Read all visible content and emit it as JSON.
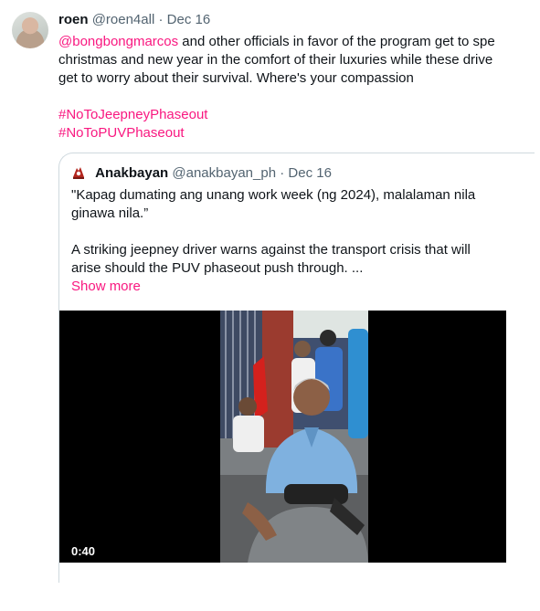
{
  "tweet": {
    "author_name": "roen",
    "author_handle": "@roen4all",
    "date": "Dec 16",
    "separator": " · ",
    "lines": [
      {
        "mention": "@bongbongmarcos",
        "text": " and other officials in favor of the program get to spe"
      },
      {
        "text": "christmas and new year in the comfort of their luxuries while these drive"
      },
      {
        "text": "get to worry about their survival. Where's your compassion"
      }
    ],
    "hashtags": [
      "#NoToJeepneyPhaseout",
      "#NoToPUVPhaseout"
    ]
  },
  "quote": {
    "author_name": "Anakbayan",
    "author_handle": "@anakbayan_ph",
    "date": "Dec 16",
    "separator": " · ",
    "lines": [
      "\"Kapag dumating ang unang work week (ng 2024), malalaman nila",
      "ginawa nila.”",
      "",
      "A striking jeepney driver warns against the transport crisis that will",
      "arise should the PUV phaseout push through. ..."
    ],
    "show_more": "Show more",
    "video_duration": "0:40"
  },
  "icons": {
    "quote_logo": "anakbayan-logo-icon",
    "avatar": "user-avatar"
  },
  "colors": {
    "accent": "#f91880",
    "secondary_text": "#536471",
    "border": "#cfd9de"
  }
}
